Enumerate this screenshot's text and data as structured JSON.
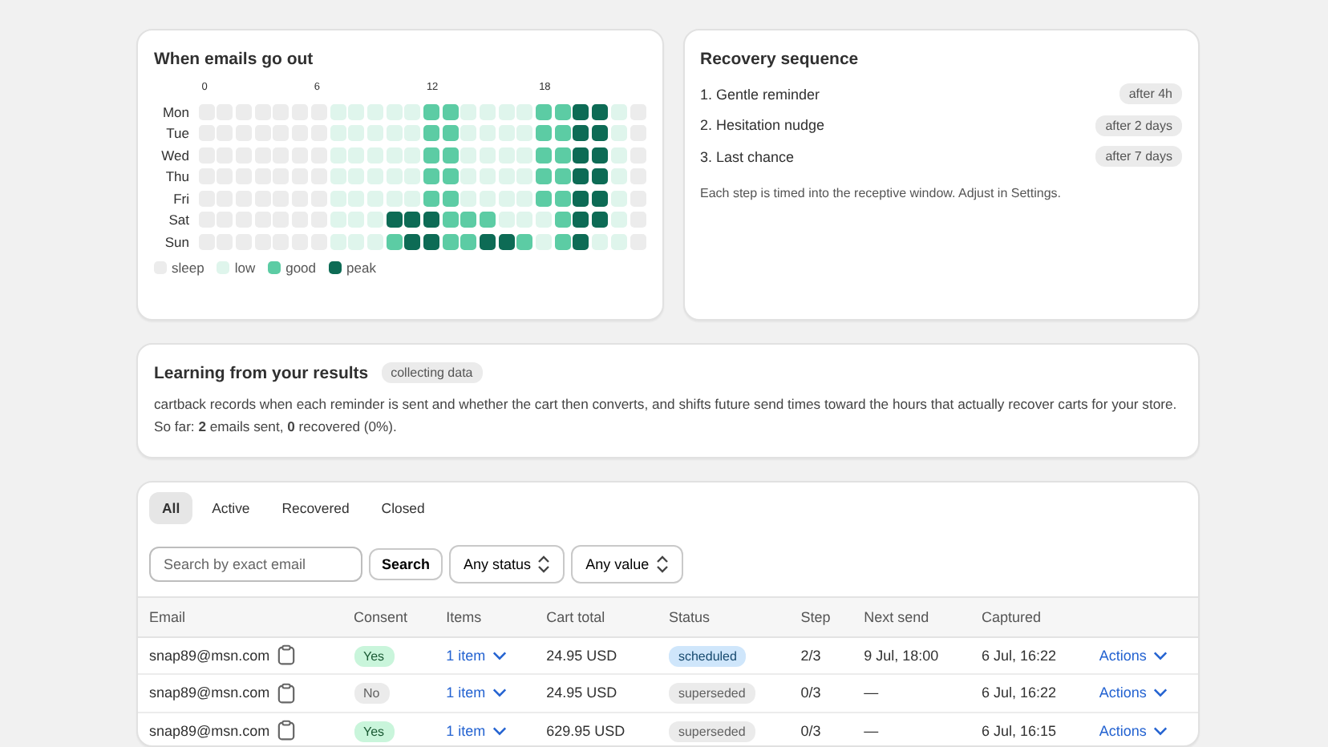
{
  "heatmap": {
    "title": "When emails go out",
    "hour_labels": [
      "0",
      "6",
      "12",
      "18"
    ],
    "legend": [
      {
        "kind": "sleep",
        "label": "sleep"
      },
      {
        "kind": "low",
        "label": "low"
      },
      {
        "kind": "good",
        "label": "good"
      },
      {
        "kind": "peak",
        "label": "peak"
      }
    ],
    "rows": [
      {
        "day": "Mon",
        "cells": [
          {
            "kind": "sleep"
          },
          {
            "kind": "sleep"
          },
          {
            "kind": "sleep"
          },
          {
            "kind": "sleep"
          },
          {
            "kind": "sleep"
          },
          {
            "kind": "sleep"
          },
          {
            "kind": "sleep"
          },
          {
            "kind": "low"
          },
          {
            "kind": "low"
          },
          {
            "kind": "low"
          },
          {
            "kind": "low"
          },
          {
            "kind": "low"
          },
          {
            "kind": "good"
          },
          {
            "kind": "good"
          },
          {
            "kind": "low"
          },
          {
            "kind": "low"
          },
          {
            "kind": "low"
          },
          {
            "kind": "low"
          },
          {
            "kind": "good"
          },
          {
            "kind": "good"
          },
          {
            "kind": "peak"
          },
          {
            "kind": "peak"
          },
          {
            "kind": "low"
          },
          {
            "kind": "sleep"
          }
        ]
      },
      {
        "day": "Tue",
        "cells": [
          {
            "kind": "sleep"
          },
          {
            "kind": "sleep"
          },
          {
            "kind": "sleep"
          },
          {
            "kind": "sleep"
          },
          {
            "kind": "sleep"
          },
          {
            "kind": "sleep"
          },
          {
            "kind": "sleep"
          },
          {
            "kind": "low"
          },
          {
            "kind": "low"
          },
          {
            "kind": "low"
          },
          {
            "kind": "low"
          },
          {
            "kind": "low"
          },
          {
            "kind": "good"
          },
          {
            "kind": "good"
          },
          {
            "kind": "low"
          },
          {
            "kind": "low"
          },
          {
            "kind": "low"
          },
          {
            "kind": "low"
          },
          {
            "kind": "good"
          },
          {
            "kind": "good"
          },
          {
            "kind": "peak"
          },
          {
            "kind": "peak"
          },
          {
            "kind": "low"
          },
          {
            "kind": "sleep"
          }
        ]
      },
      {
        "day": "Wed",
        "cells": [
          {
            "kind": "sleep"
          },
          {
            "kind": "sleep"
          },
          {
            "kind": "sleep"
          },
          {
            "kind": "sleep"
          },
          {
            "kind": "sleep"
          },
          {
            "kind": "sleep"
          },
          {
            "kind": "sleep"
          },
          {
            "kind": "low"
          },
          {
            "kind": "low"
          },
          {
            "kind": "low"
          },
          {
            "kind": "low"
          },
          {
            "kind": "low"
          },
          {
            "kind": "good"
          },
          {
            "kind": "good"
          },
          {
            "kind": "low"
          },
          {
            "kind": "low"
          },
          {
            "kind": "low"
          },
          {
            "kind": "low"
          },
          {
            "kind": "good"
          },
          {
            "kind": "good"
          },
          {
            "kind": "peak"
          },
          {
            "kind": "peak"
          },
          {
            "kind": "low"
          },
          {
            "kind": "sleep"
          }
        ]
      },
      {
        "day": "Thu",
        "cells": [
          {
            "kind": "sleep"
          },
          {
            "kind": "sleep"
          },
          {
            "kind": "sleep"
          },
          {
            "kind": "sleep"
          },
          {
            "kind": "sleep"
          },
          {
            "kind": "sleep"
          },
          {
            "kind": "sleep"
          },
          {
            "kind": "low"
          },
          {
            "kind": "low"
          },
          {
            "kind": "low"
          },
          {
            "kind": "low"
          },
          {
            "kind": "low"
          },
          {
            "kind": "good"
          },
          {
            "kind": "good"
          },
          {
            "kind": "low"
          },
          {
            "kind": "low"
          },
          {
            "kind": "low"
          },
          {
            "kind": "low"
          },
          {
            "kind": "good"
          },
          {
            "kind": "good"
          },
          {
            "kind": "peak"
          },
          {
            "kind": "peak"
          },
          {
            "kind": "low"
          },
          {
            "kind": "sleep"
          }
        ]
      },
      {
        "day": "Fri",
        "cells": [
          {
            "kind": "sleep"
          },
          {
            "kind": "sleep"
          },
          {
            "kind": "sleep"
          },
          {
            "kind": "sleep"
          },
          {
            "kind": "sleep"
          },
          {
            "kind": "sleep"
          },
          {
            "kind": "sleep"
          },
          {
            "kind": "low"
          },
          {
            "kind": "low"
          },
          {
            "kind": "low"
          },
          {
            "kind": "low"
          },
          {
            "kind": "low"
          },
          {
            "kind": "good"
          },
          {
            "kind": "good"
          },
          {
            "kind": "low"
          },
          {
            "kind": "low"
          },
          {
            "kind": "low"
          },
          {
            "kind": "low"
          },
          {
            "kind": "good"
          },
          {
            "kind": "good"
          },
          {
            "kind": "peak"
          },
          {
            "kind": "peak"
          },
          {
            "kind": "low"
          },
          {
            "kind": "sleep"
          }
        ]
      },
      {
        "day": "Sat",
        "cells": [
          {
            "kind": "sleep"
          },
          {
            "kind": "sleep"
          },
          {
            "kind": "sleep"
          },
          {
            "kind": "sleep"
          },
          {
            "kind": "sleep"
          },
          {
            "kind": "sleep"
          },
          {
            "kind": "sleep"
          },
          {
            "kind": "low"
          },
          {
            "kind": "low"
          },
          {
            "kind": "low"
          },
          {
            "kind": "peak"
          },
          {
            "kind": "peak"
          },
          {
            "kind": "peak"
          },
          {
            "kind": "good"
          },
          {
            "kind": "good"
          },
          {
            "kind": "good"
          },
          {
            "kind": "low"
          },
          {
            "kind": "low"
          },
          {
            "kind": "low"
          },
          {
            "kind": "good"
          },
          {
            "kind": "peak"
          },
          {
            "kind": "peak"
          },
          {
            "kind": "low"
          },
          {
            "kind": "sleep"
          }
        ]
      },
      {
        "day": "Sun",
        "cells": [
          {
            "kind": "sleep"
          },
          {
            "kind": "sleep"
          },
          {
            "kind": "sleep"
          },
          {
            "kind": "sleep"
          },
          {
            "kind": "sleep"
          },
          {
            "kind": "sleep"
          },
          {
            "kind": "sleep"
          },
          {
            "kind": "low"
          },
          {
            "kind": "low"
          },
          {
            "kind": "low"
          },
          {
            "kind": "good"
          },
          {
            "kind": "peak"
          },
          {
            "kind": "peak"
          },
          {
            "kind": "good"
          },
          {
            "kind": "good"
          },
          {
            "kind": "peak"
          },
          {
            "kind": "peak"
          },
          {
            "kind": "good"
          },
          {
            "kind": "low"
          },
          {
            "kind": "good"
          },
          {
            "kind": "peak"
          },
          {
            "kind": "low"
          },
          {
            "kind": "low"
          },
          {
            "kind": "sleep"
          }
        ]
      }
    ]
  },
  "sequence": {
    "title": "Recovery sequence",
    "steps": [
      {
        "name": "1. Gentle reminder",
        "delay": "after 4h"
      },
      {
        "name": "2. Hesitation nudge",
        "delay": "after 2 days"
      },
      {
        "name": "3. Last chance",
        "delay": "after 7 days"
      }
    ],
    "note": "Each step is timed into the receptive window. Adjust in Settings."
  },
  "learning": {
    "title": "Learning from your results",
    "badge": "collecting data",
    "text": "cartback records when each reminder is sent and whether the cart then converts, and shifts future send times toward the hours that actually recover carts for your store. So far: **2** emails sent, **0** recovered (0%)."
  },
  "tabs": [
    {
      "label": "All",
      "selected": true
    },
    {
      "label": "Active",
      "selected": false
    },
    {
      "label": "Recovered",
      "selected": false
    },
    {
      "label": "Closed",
      "selected": false
    }
  ],
  "search": {
    "placeholder": "Search by exact email",
    "button": "Search"
  },
  "filters": [
    "Any status",
    "Any value"
  ],
  "table": {
    "columns": [
      "Email",
      "Consent",
      "Items",
      "Cart total",
      "Status",
      "Step",
      "Next send",
      "Captured"
    ],
    "rows": [
      {
        "email": "snap89@msn.com",
        "consent": "Yes",
        "consent_ok": true,
        "items": "1 item",
        "total": "24.95 USD",
        "status": "scheduled",
        "kind": "scheduled",
        "step": "2/3",
        "next_send": "9 Jul, 18:00",
        "captured": "6 Jul, 16:22",
        "action": "Actions"
      },
      {
        "email": "snap89@msn.com",
        "consent": "No",
        "consent_ok": false,
        "items": "1 item",
        "total": "24.95 USD",
        "status": "superseded",
        "kind": "superseded",
        "step": "0/3",
        "next_send": "—",
        "captured": "6 Jul, 16:22",
        "action": "Actions"
      },
      {
        "email": "snap89@msn.com",
        "consent": "Yes",
        "consent_ok": true,
        "items": "1 item",
        "total": "629.95 USD",
        "status": "superseded",
        "kind": "superseded",
        "step": "0/3",
        "next_send": "—",
        "captured": "6 Jul, 16:15",
        "action": "Actions"
      }
    ]
  }
}
